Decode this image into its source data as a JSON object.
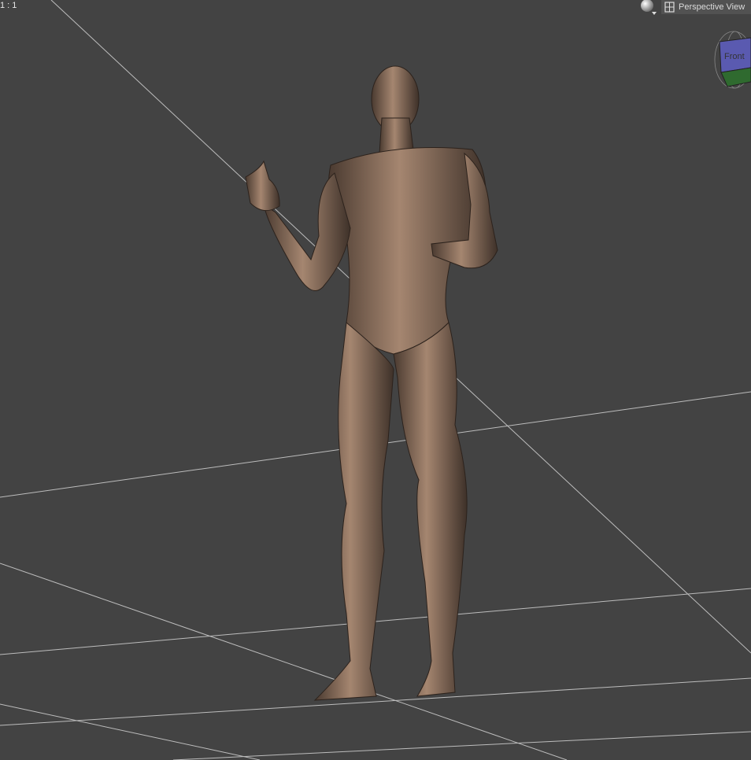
{
  "viewport": {
    "aspect_ratio_label": "1 : 1",
    "view_selector_label": "Perspective View",
    "cube_face_label": "Front",
    "background_color": "#434343"
  }
}
